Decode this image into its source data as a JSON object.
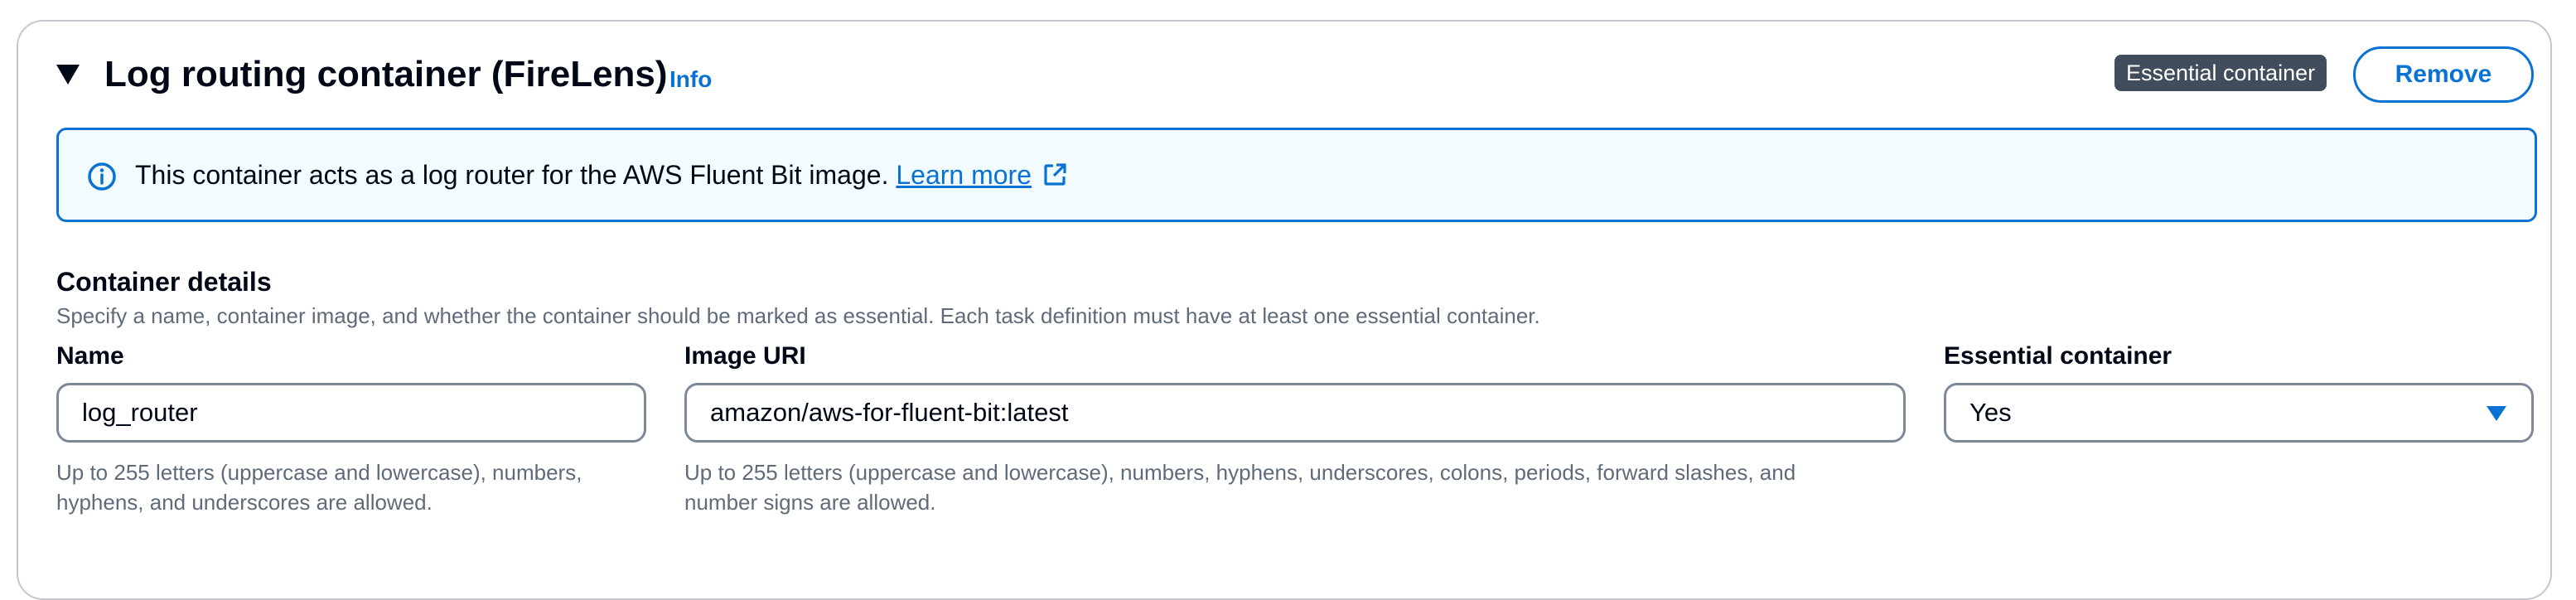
{
  "header": {
    "title": "Log routing container (FireLens)",
    "info_link": "Info",
    "badge": "Essential container",
    "remove_label": "Remove"
  },
  "alert": {
    "text": "This container acts as a log router for the AWS Fluent Bit image.",
    "link": "Learn more",
    "icon": "info-circle-icon",
    "link_icon": "external-link-icon"
  },
  "details": {
    "title": "Container details",
    "description": "Specify a name, container image, and whether the container should be marked as essential. Each task definition must have at least one essential container."
  },
  "fields": {
    "name": {
      "label": "Name",
      "value": "log_router",
      "hint_line1": "Up to 255 letters (uppercase and lowercase), numbers,",
      "hint_line2": "hyphens, and underscores are allowed."
    },
    "image_uri": {
      "label": "Image URI",
      "value": "amazon/aws-for-fluent-bit:latest",
      "hint_line1": "Up to 255 letters (uppercase and lowercase), numbers, hyphens, underscores, colons, periods, forward slashes, and",
      "hint_line2": "number signs are allowed."
    },
    "essential": {
      "label": "Essential container",
      "value": "Yes"
    }
  },
  "colors": {
    "accent": "#0972d3",
    "alert_bg": "#f2fbff",
    "badge_bg": "#414d5c",
    "text": "#000716",
    "secondary_text": "#5f6b7a",
    "border": "#7d8998"
  }
}
